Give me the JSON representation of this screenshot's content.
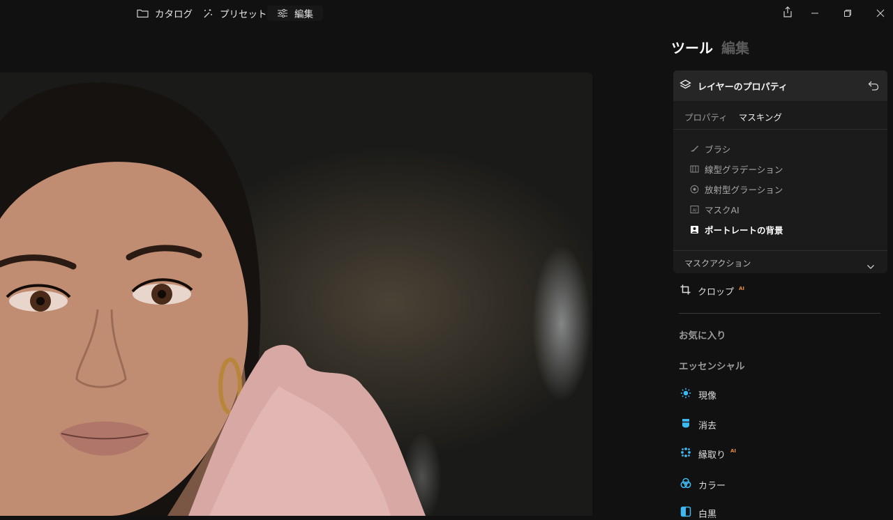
{
  "topbar": {
    "catalog_label": "カタログ",
    "presets_label": "プリセット",
    "edit_label": "編集"
  },
  "panel": {
    "title_active": "ツール",
    "title_inactive": "編集",
    "layer_card": {
      "title": "レイヤーのプロパティ",
      "tabs": [
        "プロパティ",
        "マスキング"
      ],
      "active_tab": "マスキング",
      "mask_tools": [
        {
          "label": "ブラシ",
          "icon": "brush-icon"
        },
        {
          "label": "線型グラデーション",
          "icon": "linear-gradient-icon"
        },
        {
          "label": "放射型グラーション",
          "icon": "radial-gradient-icon"
        },
        {
          "label": "マスクAI",
          "icon": "mask-ai-icon"
        },
        {
          "label": "ポートレートの背景",
          "icon": "portrait-background-icon"
        }
      ],
      "active_mask_tool": "ポートレートの背景",
      "mask_actions_label": "マスクアクション"
    },
    "crop_label": "クロップ",
    "ai_badge": "AI",
    "favorites_label": "お気に入り",
    "essentials_label": "エッセンシャル",
    "essentials": [
      {
        "label": "現像",
        "icon": "develop-icon",
        "ai": false
      },
      {
        "label": "消去",
        "icon": "erase-icon",
        "ai": false
      },
      {
        "label": "縁取り",
        "icon": "edge-icon",
        "ai": true
      },
      {
        "label": "カラー",
        "icon": "color-icon",
        "ai": false
      },
      {
        "label": "白黒",
        "icon": "black-white-icon",
        "ai": false
      }
    ]
  },
  "colors": {
    "accent": "#3db8f0",
    "ai_badge": "#e08a3a",
    "background": "#111111"
  }
}
